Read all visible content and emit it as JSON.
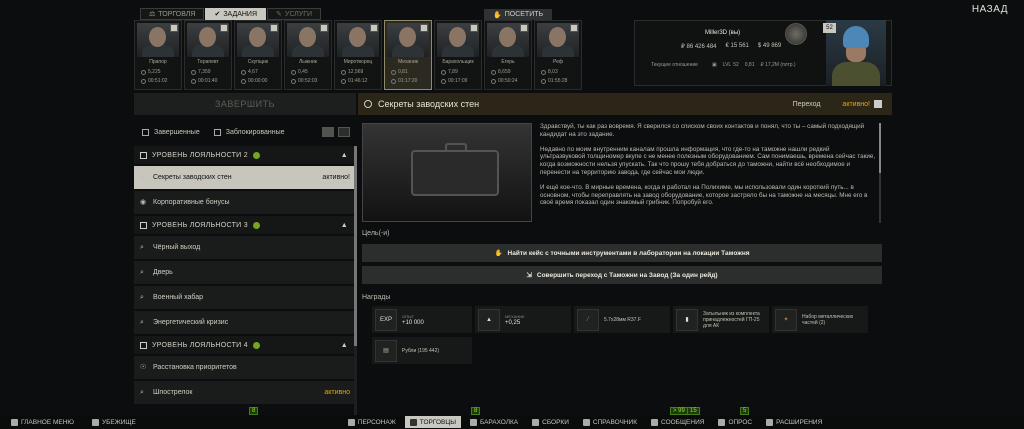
{
  "topnav": {
    "tabs": [
      {
        "label": "ТОРГОВЛЯ",
        "active": false
      },
      {
        "label": "ЗАДАНИЯ",
        "active": true
      },
      {
        "label": "УСЛУГИ",
        "active": false
      }
    ],
    "visit_label": "ПОСЕТИТЬ",
    "back_label": "НАЗАД"
  },
  "traders": [
    {
      "name": "Прапор",
      "stat1": "5,225",
      "stat2": "00:51:02"
    },
    {
      "name": "Терапевт",
      "stat1": "7,359",
      "stat2": "00:01:40"
    },
    {
      "name": "Скупщик",
      "stat1": "4,67",
      "stat2": "00:00:00"
    },
    {
      "name": "Лыжник",
      "stat1": "0,45",
      "stat2": "00:52:03"
    },
    {
      "name": "Миротворец",
      "stat1": "12,569",
      "stat2": "01:46:12"
    },
    {
      "name": "Механик",
      "stat1": "0,81",
      "stat2": "01:17:20"
    },
    {
      "name": "Барахольщик",
      "stat1": "7,89",
      "stat2": "00:17:09"
    },
    {
      "name": "Егерь",
      "stat1": "8,659",
      "stat2": "00:50:24"
    },
    {
      "name": "Реф",
      "stat1": "8,03",
      "stat2": "01:55:28"
    }
  ],
  "player": {
    "name": "Miller3D (вы)",
    "rub": "₽ 86 426 484",
    "eur": "€ 15 561",
    "usd": "$ 49 869",
    "standing_label": "Текущее отношение",
    "level_label": "LVL",
    "level": "52",
    "standing": "0,81",
    "spent": "₽ 17,2M (потр.)",
    "badge_level": "52"
  },
  "left": {
    "complete_label": "ЗАВЕРШИТЬ",
    "filter_completed": "Завершенные",
    "filter_locked": "Заблокированные",
    "groups": [
      {
        "title": "УРОВЕНЬ ЛОЯЛЬНОСТИ 2",
        "quests": [
          {
            "label": "Секреты заводских стен",
            "status": "активно!",
            "active": true
          },
          {
            "label": "Корпоративные бонусы",
            "status": "",
            "active": false
          }
        ]
      },
      {
        "title": "УРОВЕНЬ ЛОЯЛЬНОСТИ 3",
        "quests": [
          {
            "label": "Чёрный выход",
            "status": ""
          },
          {
            "label": "Дверь",
            "status": ""
          },
          {
            "label": "Военный хабар",
            "status": ""
          },
          {
            "label": "Энергетический кризис",
            "status": ""
          }
        ]
      },
      {
        "title": "УРОВЕНЬ ЛОЯЛЬНОСТИ 4",
        "quests": [
          {
            "label": "Расстановка приоритетов",
            "status": ""
          },
          {
            "label": "Шпострелок",
            "status": "активно"
          }
        ]
      }
    ]
  },
  "quest": {
    "title": "Секреты заводских стен",
    "trader_label": "Переход",
    "status": "активно!",
    "text": [
      "Здравствуй, ты как раз вовремя. Я сверился со списком своих контактов и понял, что ты – самый подходящий кандидат на это задание.",
      "Недавно по моим внутренним каналам прошла информация, что где-то на таможне нашли редкий ультразвуковой толщиномер вкупе с не менее полезным оборудованием. Сам понимаешь, времена сейчас такие, когда возможности нельзя упускать. Так что прошу тебя добраться до таможни, найти всё необходимое и перенести на территорию завода, где сейчас мои люди.",
      "И ещё кое-что. В мирные времена, когда я работал на Полихиме, мы использовали один короткий путь... в основном, чтобы переправлять на завод оборудование, которое застряло бы на таможне на месяцы. Мне его в своё время показал один знакомый грибник. Попробуй его."
    ],
    "goals_label": "Цель(-и)",
    "objectives": [
      "Найти кейс с точными инструментами в лаборатории на локации Таможня",
      "Совершить переход с Таможни на Завод (За один рейд)"
    ],
    "rewards_label": "Награды",
    "rewards": [
      {
        "icon": "EXP",
        "small": "ОПЫТ",
        "value": "+10 000"
      },
      {
        "icon": "arrow-up-icon",
        "small": "МЕХАНИК",
        "value": "+0,25"
      },
      {
        "icon": "ammo-icon",
        "small": "",
        "value": "5.7x28мм R37.F"
      },
      {
        "icon": "part-icon",
        "small": "",
        "value": "Затыльник из комплекта принадлежностей ГП-25 для АК"
      },
      {
        "icon": "parts-icon",
        "small": "",
        "value": "Набор металлических частей (2)"
      },
      {
        "icon": "money-icon",
        "small": "",
        "value": "Рубли (195 442)"
      }
    ]
  },
  "bottom": {
    "items": [
      {
        "label": "ГЛАВНОЕ МЕНЮ"
      },
      {
        "label": "УБЕЖИЩЕ"
      },
      {
        "label": "ПЕРСОНАЖ"
      },
      {
        "label": "ТОРГОВЦЫ",
        "selected": true
      },
      {
        "label": "БАРАХОЛКА"
      },
      {
        "label": "СБОРКИ"
      },
      {
        "label": "СПРАВОЧНИК"
      },
      {
        "label": "СООБЩЕНИЯ"
      },
      {
        "label": "ОПРОС"
      },
      {
        "label": "РАСШИРЕНИЯ"
      }
    ],
    "badges": {
      "b1": "8",
      "b2": "> 99",
      "b3": "15",
      "b4": "5"
    }
  }
}
